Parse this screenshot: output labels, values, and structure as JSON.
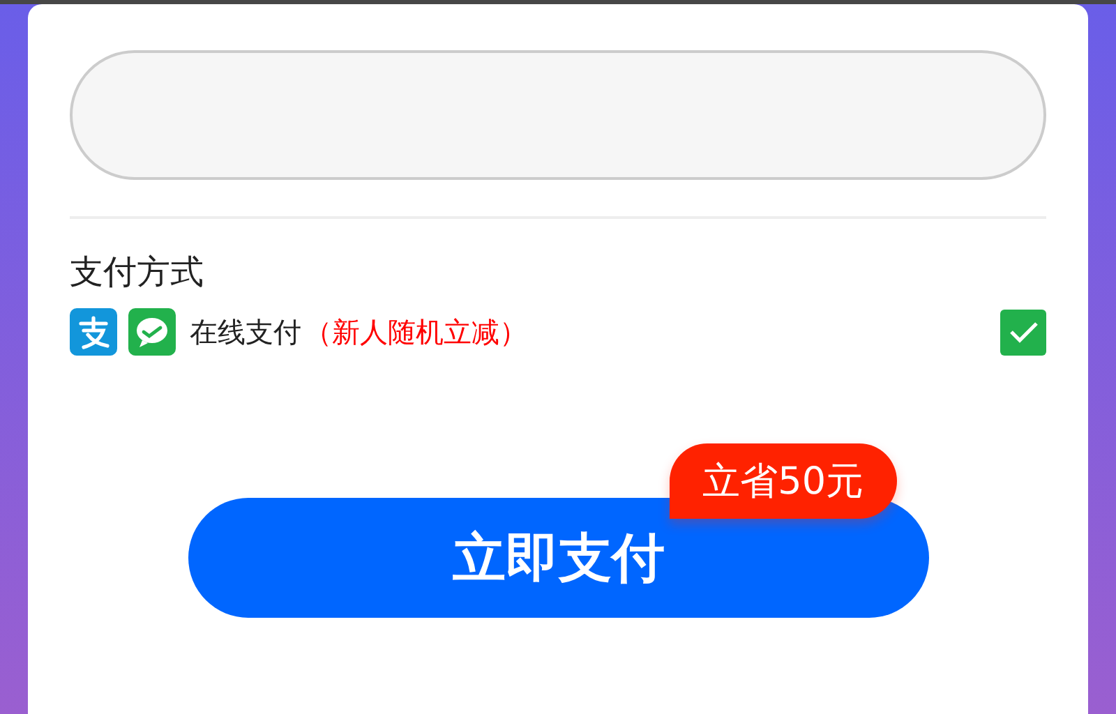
{
  "payment_section": {
    "title": "支付方式",
    "methods": [
      {
        "label": "在线支付",
        "note": "（新人随机立减）",
        "checked": true
      }
    ]
  },
  "pay_button": {
    "label": "立即支付",
    "badge": "立省50元"
  }
}
